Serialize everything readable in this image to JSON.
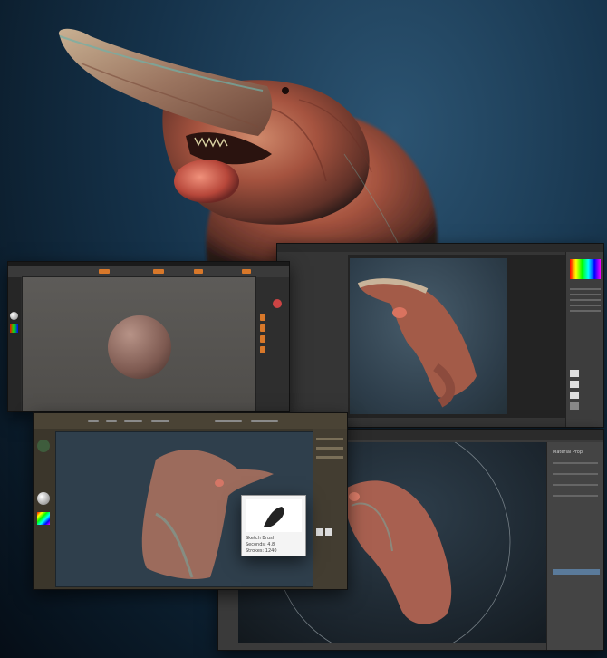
{
  "composite": {
    "description_hidden": ""
  },
  "hero": {
    "icon": "creature-render"
  },
  "zbrush_window_1": {
    "tool": "sphere-primitive",
    "color_swatch": "#d8782a"
  },
  "photoshop_window": {
    "panel_labels": [
      "",
      "",
      "",
      "",
      ""
    ],
    "layers_count": "8"
  },
  "zbrush_window_2": {
    "accent": "#5a4e3a"
  },
  "popup": {
    "lines": [
      "Sketch Brush",
      "Seconds: 4.8",
      "Strokes: 1240"
    ]
  },
  "app_window_3": {
    "panel_title": "Material Prop",
    "items": [
      "",
      "",
      "",
      ""
    ]
  },
  "colors": {
    "bg_top": "#2c5472",
    "bg_bottom": "#050d16",
    "flesh": "#b5624c",
    "teal_highlight": "#6fb0a8"
  }
}
